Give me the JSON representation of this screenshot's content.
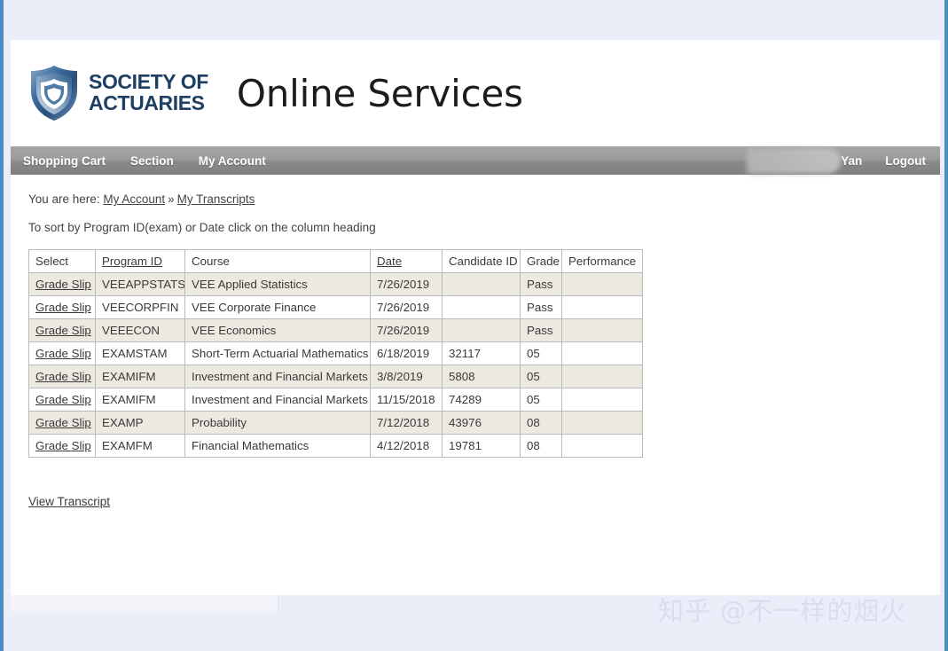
{
  "site": {
    "logo_line1": "SOCIETY OF",
    "logo_line2": "ACTUARIES",
    "title": "Online Services"
  },
  "nav": {
    "left_items": [
      {
        "label": "Shopping Cart",
        "name": "nav-shopping-cart"
      },
      {
        "label": "Section",
        "name": "nav-section"
      },
      {
        "label": "My Account",
        "name": "nav-my-account"
      }
    ],
    "right_items": [
      {
        "label": "Yan",
        "name": "nav-user-name"
      },
      {
        "label": "Logout",
        "name": "nav-logout"
      }
    ]
  },
  "breadcrumb": {
    "prefix": "You are here:",
    "link1": "My Account",
    "separator": "»",
    "link2": "My Transcripts"
  },
  "sort_hint": "To sort by Program ID(exam) or Date click on the column heading",
  "table": {
    "headers": [
      {
        "label": "Select",
        "sortable": false
      },
      {
        "label": "Program ID",
        "sortable": true
      },
      {
        "label": "Course",
        "sortable": false
      },
      {
        "label": "Date",
        "sortable": true
      },
      {
        "label": "Candidate ID",
        "sortable": false
      },
      {
        "label": "Grade",
        "sortable": false
      },
      {
        "label": "Performance",
        "sortable": false
      }
    ],
    "select_link_label": "Grade Slip",
    "rows": [
      {
        "select": "Grade Slip",
        "program_id": "VEEAPPSTATS",
        "course": "VEE Applied Statistics",
        "date": "7/26/2019",
        "candidate_id": "",
        "grade": "Pass",
        "performance": ""
      },
      {
        "select": "Grade Slip",
        "program_id": "VEECORPFIN",
        "course": "VEE Corporate Finance",
        "date": "7/26/2019",
        "candidate_id": "",
        "grade": "Pass",
        "performance": ""
      },
      {
        "select": "Grade Slip",
        "program_id": "VEEECON",
        "course": "VEE Economics",
        "date": "7/26/2019",
        "candidate_id": "",
        "grade": "Pass",
        "performance": ""
      },
      {
        "select": "Grade Slip",
        "program_id": "EXAMSTAM",
        "course": "Short-Term Actuarial Mathematics",
        "date": "6/18/2019",
        "candidate_id": "32117",
        "grade": "05",
        "performance": ""
      },
      {
        "select": "Grade Slip",
        "program_id": "EXAMIFM",
        "course": "Investment and Financial Markets",
        "date": "3/8/2019",
        "candidate_id": "5808",
        "grade": "05",
        "performance": ""
      },
      {
        "select": "Grade Slip",
        "program_id": "EXAMIFM",
        "course": "Investment and Financial Markets",
        "date": "11/15/2018",
        "candidate_id": "74289",
        "grade": "05",
        "performance": ""
      },
      {
        "select": "Grade Slip",
        "program_id": "EXAMP",
        "course": "Probability",
        "date": "7/12/2018",
        "candidate_id": "43976",
        "grade": "08",
        "performance": ""
      },
      {
        "select": "Grade Slip",
        "program_id": "EXAMFM",
        "course": "Financial Mathematics",
        "date": "4/12/2018",
        "candidate_id": "19781",
        "grade": "08",
        "performance": ""
      }
    ]
  },
  "view_transcript_label": "View Transcript",
  "watermark": "知乎 @不一样的烟火",
  "colors": {
    "navbar_gray": "#9b9b9b",
    "logo_blue": "#1d3f63",
    "rail_blue": "#4a8ec2",
    "row_alt": "#ece9e0",
    "page_background": "#ebeef8"
  }
}
